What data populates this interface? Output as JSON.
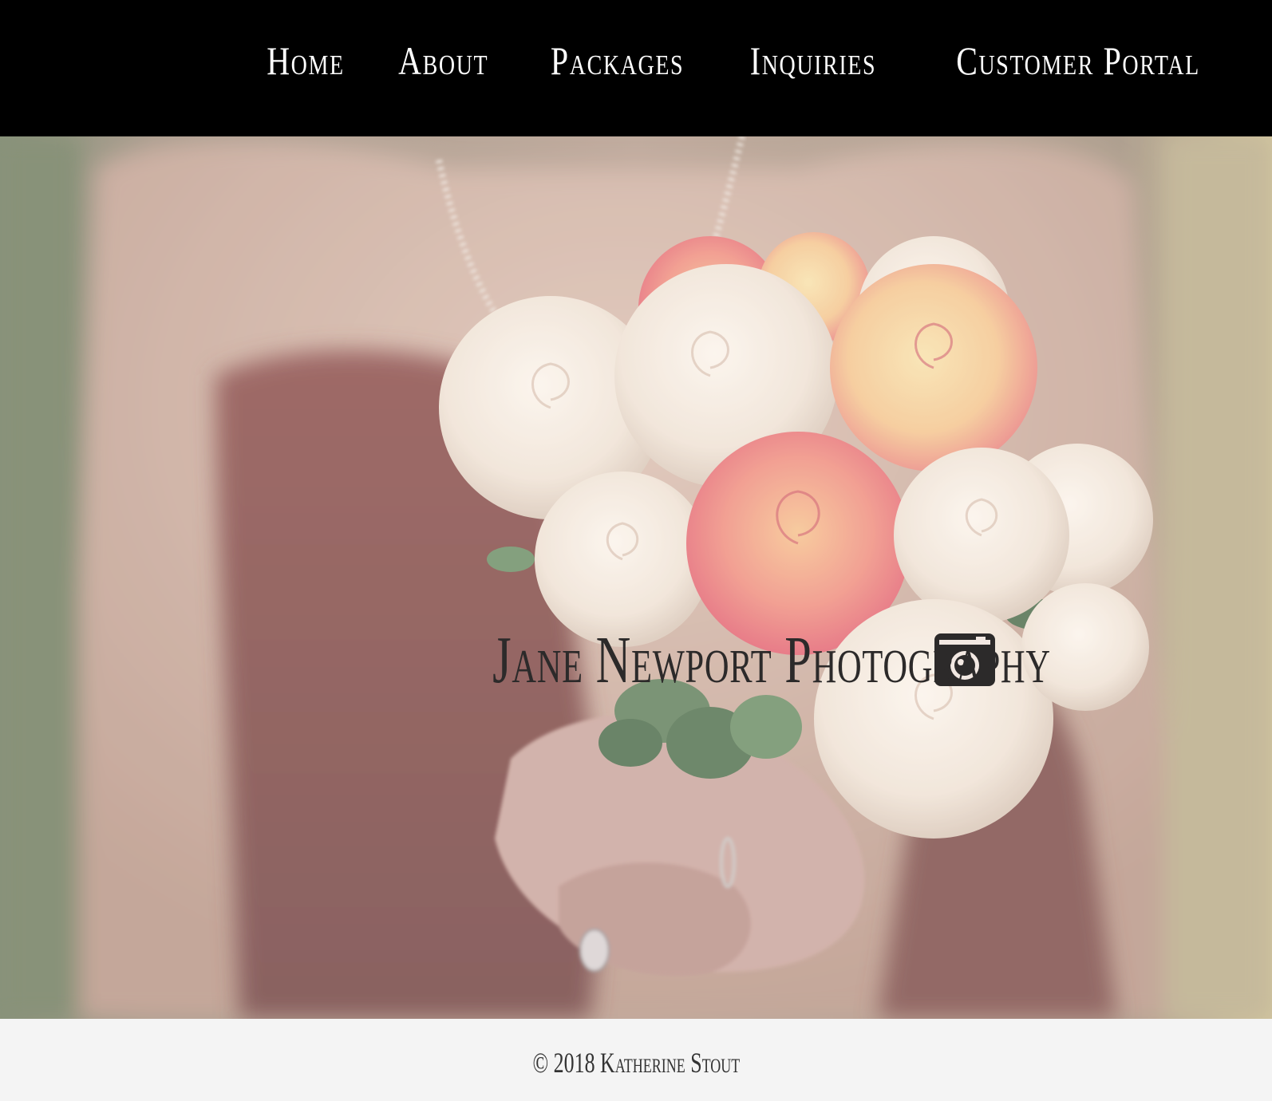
{
  "nav": {
    "items": [
      {
        "label": "Home"
      },
      {
        "label": "About"
      },
      {
        "label": "Packages"
      },
      {
        "label": "Inquiries"
      },
      {
        "label": "Customer Portal"
      }
    ]
  },
  "hero": {
    "title": "Jane Newport Photography",
    "icon": "camera-icon"
  },
  "footer": {
    "copyright": "© 2018 Katherine Stout"
  },
  "colors": {
    "navbar_bg": "#000000",
    "nav_text": "#ffffff",
    "title_text": "#2c2a2a",
    "footer_bg": "#f4f4f4",
    "footer_text": "#333333"
  }
}
